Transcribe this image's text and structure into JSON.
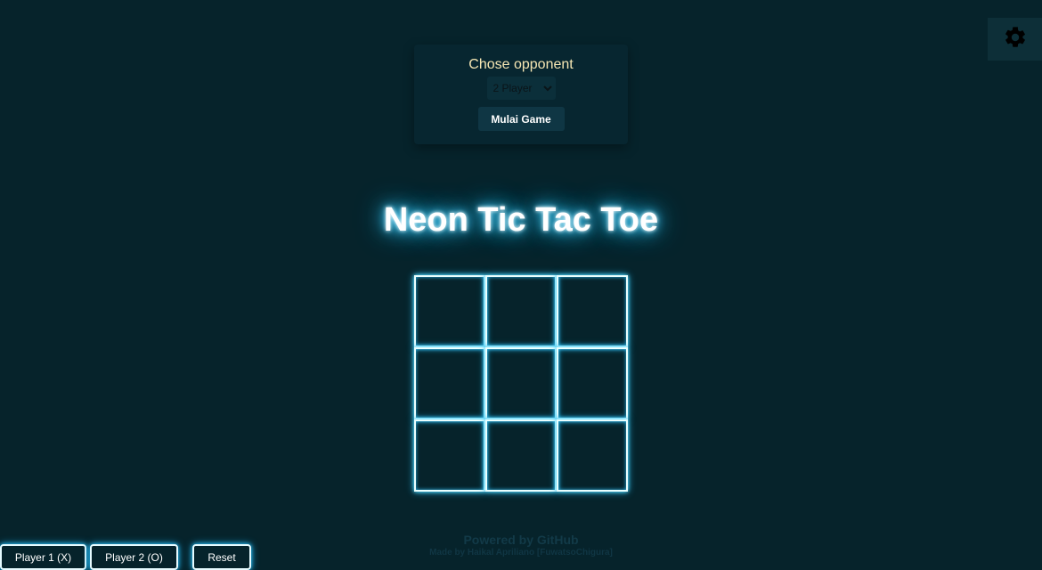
{
  "settings": {
    "icon": "gear-icon"
  },
  "opponent_panel": {
    "title": "Chose opponent",
    "selected_option": "2 Player",
    "start_label": "Mulai Game"
  },
  "game": {
    "title": "Neon Tic Tac Toe",
    "board": [
      "",
      "",
      "",
      "",
      "",
      "",
      "",
      "",
      ""
    ]
  },
  "footer": {
    "powered": "Powered by GitHub",
    "made_by": "Made by Haikal Apriliano [FuwatsoChigura]"
  },
  "controls": {
    "player1_label": "Player 1 (X)",
    "player2_label": "Player 2 (O)",
    "reset_label": "Reset"
  },
  "colors": {
    "background": "#06232b",
    "neon_glow": "#3fd0ff",
    "panel_title": "#f5e6b3"
  }
}
